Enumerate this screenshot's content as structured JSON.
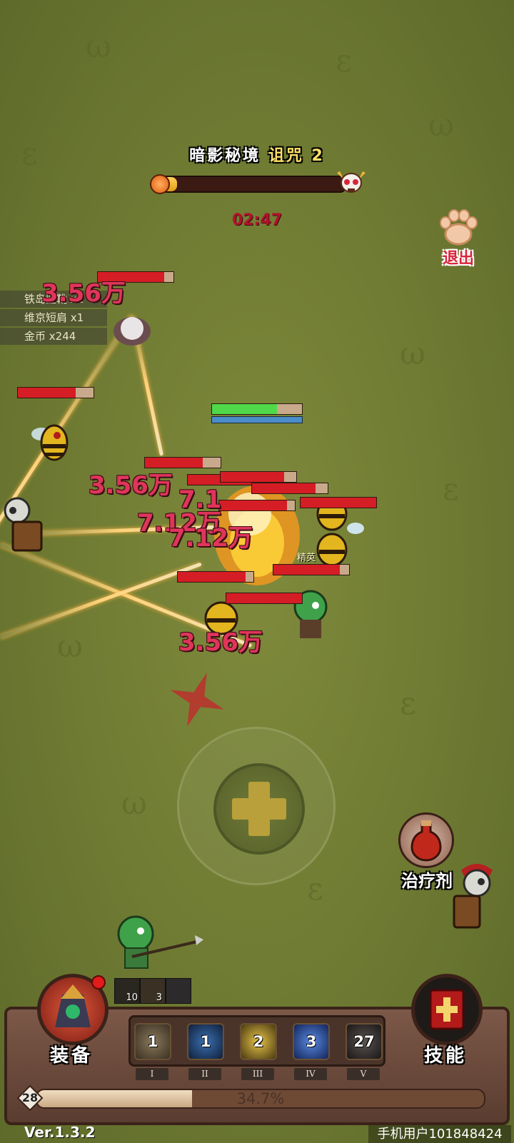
{
  "stage": {
    "name": "暗影秘境",
    "curse": "诅咒 2",
    "progress_fraction": 0.12,
    "timer": "02:47"
  },
  "exit_button": {
    "label": "退出"
  },
  "loot_log": [
    {
      "text": "铁岛坚靴 x1"
    },
    {
      "text": "维京短肩 x1"
    },
    {
      "text": "金币 x244"
    }
  ],
  "damage_numbers": [
    {
      "text": "3.56万"
    },
    {
      "text": "3.56万"
    },
    {
      "text": "7.1"
    },
    {
      "text": "7.12万"
    },
    {
      "text": "7.12万"
    },
    {
      "text": "3.56万"
    }
  ],
  "elite_label": "精英",
  "potion_button": {
    "label": "治疗剂"
  },
  "buff_icons": [
    {
      "count": "10"
    },
    {
      "count": "3"
    },
    {
      "count": ""
    }
  ],
  "equipment_button": {
    "label": "装备"
  },
  "skills_button": {
    "label": "技能"
  },
  "skill_slots": [
    {
      "level": "1",
      "roman": "I"
    },
    {
      "level": "1",
      "roman": "II"
    },
    {
      "level": "2",
      "roman": "III"
    },
    {
      "level": "3",
      "roman": "IV"
    },
    {
      "level": "27",
      "roman": "V"
    }
  ],
  "player": {
    "level": "28",
    "exp_percent": "34.7%",
    "exp_fraction": 0.347
  },
  "footer": {
    "version": "Ver.1.3.2",
    "user": "手机用户101848424"
  },
  "colors": {
    "grass": "#6e7a32",
    "damage_pink": "#e0355a",
    "hp_red": "#d51d25",
    "panel_brown": "#6b4a3a"
  }
}
